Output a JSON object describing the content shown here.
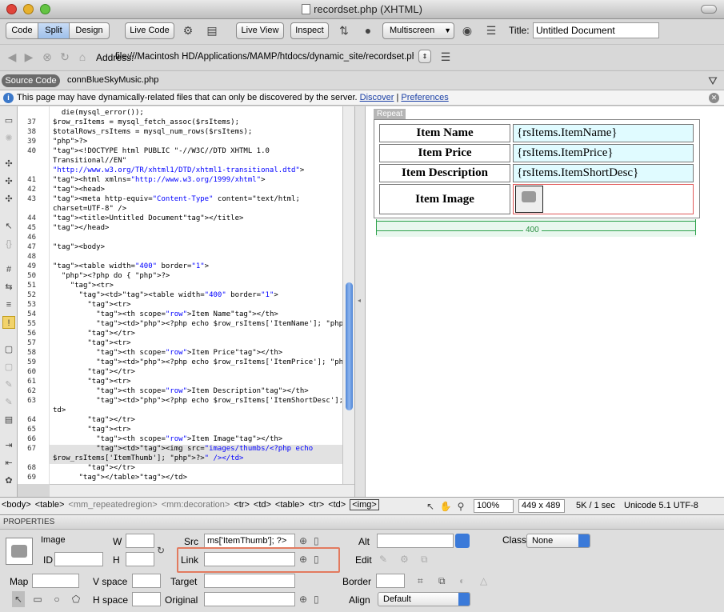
{
  "window": {
    "title": "recordset.php (XHTML)"
  },
  "toolbar": {
    "view_buttons": [
      "Code",
      "Split",
      "Design"
    ],
    "live_code": "Live Code",
    "live_view": "Live View",
    "inspect": "Inspect",
    "multiscreen": "Multiscreen",
    "title_label": "Title:",
    "title_value": "Untitled Document"
  },
  "address": {
    "label": "Address:",
    "value": "file:///Macintosh HD/Applications/MAMP/htdocs/dynamic_site/recordset.php"
  },
  "related_files": {
    "source_code": "Source Code",
    "file": "connBlueSkyMusic.php"
  },
  "info_bar": {
    "message": "This page may have dynamically-related files that can only be discovered by the server.",
    "discover": "Discover",
    "separator": "|",
    "preferences": "Preferences"
  },
  "code": {
    "lines": [
      {
        "n": "",
        "text": "  die(mysql_error());"
      },
      {
        "n": "37",
        "text": "$row_rsItems = mysql_fetch_assoc($rsItems);"
      },
      {
        "n": "38",
        "text": "$totalRows_rsItems = mysql_num_rows($rsItems);"
      },
      {
        "n": "39",
        "text": "?>"
      },
      {
        "n": "40",
        "text": "<!DOCTYPE html PUBLIC \"-//W3C//DTD XHTML 1.0"
      },
      {
        "n": "",
        "text": "Transitional//EN\""
      },
      {
        "n": "",
        "text": "\"http://www.w3.org/TR/xhtml1/DTD/xhtml1-transitional.dtd\">"
      },
      {
        "n": "41",
        "text": "<html xmlns=\"http://www.w3.org/1999/xhtml\">"
      },
      {
        "n": "42",
        "text": "<head>"
      },
      {
        "n": "43",
        "text": "<meta http-equiv=\"Content-Type\" content=\"text/html;"
      },
      {
        "n": "",
        "text": "charset=UTF-8\" />"
      },
      {
        "n": "44",
        "text": "<title>Untitled Document</title>"
      },
      {
        "n": "45",
        "text": "</head>"
      },
      {
        "n": "46",
        "text": ""
      },
      {
        "n": "47",
        "text": "<body>"
      },
      {
        "n": "48",
        "text": ""
      },
      {
        "n": "49",
        "text": "<table width=\"400\" border=\"1\">"
      },
      {
        "n": "50",
        "text": "  <?php do { ?>"
      },
      {
        "n": "51",
        "text": "    <tr>"
      },
      {
        "n": "52",
        "text": "      <td><table width=\"400\" border=\"1\">"
      },
      {
        "n": "53",
        "text": "        <tr>"
      },
      {
        "n": "54",
        "text": "          <th scope=\"row\">Item Name</th>"
      },
      {
        "n": "55",
        "text": "          <td><?php echo $row_rsItems['ItemName']; ?></td>"
      },
      {
        "n": "56",
        "text": "        </tr>"
      },
      {
        "n": "57",
        "text": "        <tr>"
      },
      {
        "n": "58",
        "text": "          <th scope=\"row\">Item Price</th>"
      },
      {
        "n": "59",
        "text": "          <td><?php echo $row_rsItems['ItemPrice']; ?></td>"
      },
      {
        "n": "60",
        "text": "        </tr>"
      },
      {
        "n": "61",
        "text": "        <tr>"
      },
      {
        "n": "62",
        "text": "          <th scope=\"row\">Item Description</th>"
      },
      {
        "n": "63",
        "text": "          <td><?php echo $row_rsItems['ItemShortDesc']; ?></"
      },
      {
        "n": "",
        "text": "td>"
      },
      {
        "n": "64",
        "text": "        </tr>"
      },
      {
        "n": "65",
        "text": "        <tr>"
      },
      {
        "n": "66",
        "text": "          <th scope=\"row\">Item Image</th>"
      },
      {
        "n": "67",
        "text": "          <td><img src=\"images/thumbs/<?php echo"
      },
      {
        "n": "",
        "text": "$row_rsItems['ItemThumb']; ?>\" /></td>"
      },
      {
        "n": "68",
        "text": "        </tr>"
      },
      {
        "n": "69",
        "text": "      </table></td>"
      }
    ]
  },
  "design": {
    "repeat_label": "Repeat",
    "rows": [
      {
        "header": "Item Name",
        "value": "{rsItems.ItemName}"
      },
      {
        "header": "Item Price",
        "value": "{rsItems.ItemPrice}"
      },
      {
        "header": "Item Description",
        "value": "{rsItems.ItemShortDesc}"
      },
      {
        "header": "Item Image",
        "value": ""
      }
    ],
    "width_label": "400"
  },
  "status": {
    "tags": [
      "<body>",
      "<table>",
      "<mm_repeatedregion>",
      "<mm:decoration>",
      "<tr>",
      "<td>",
      "<table>",
      "<tr>",
      "<td>",
      "<img>"
    ],
    "zoom": "100%",
    "window_size": "449 x 489",
    "download": "5K / 1 sec",
    "encoding": "Unicode 5.1 UTF-8"
  },
  "properties": {
    "header": "PROPERTIES",
    "type": "Image",
    "id_label": "ID",
    "w_label": "W",
    "h_label": "H",
    "src_label": "Src",
    "src_value": "ms['ItemThumb']; ?>",
    "link_label": "Link",
    "link_value": "",
    "alt_label": "Alt",
    "edit_label": "Edit",
    "class_label": "Class",
    "class_value": "None",
    "map_label": "Map",
    "vspace_label": "V space",
    "hspace_label": "H space",
    "target_label": "Target",
    "original_label": "Original",
    "border_label": "Border",
    "align_label": "Align",
    "align_value": "Default"
  }
}
